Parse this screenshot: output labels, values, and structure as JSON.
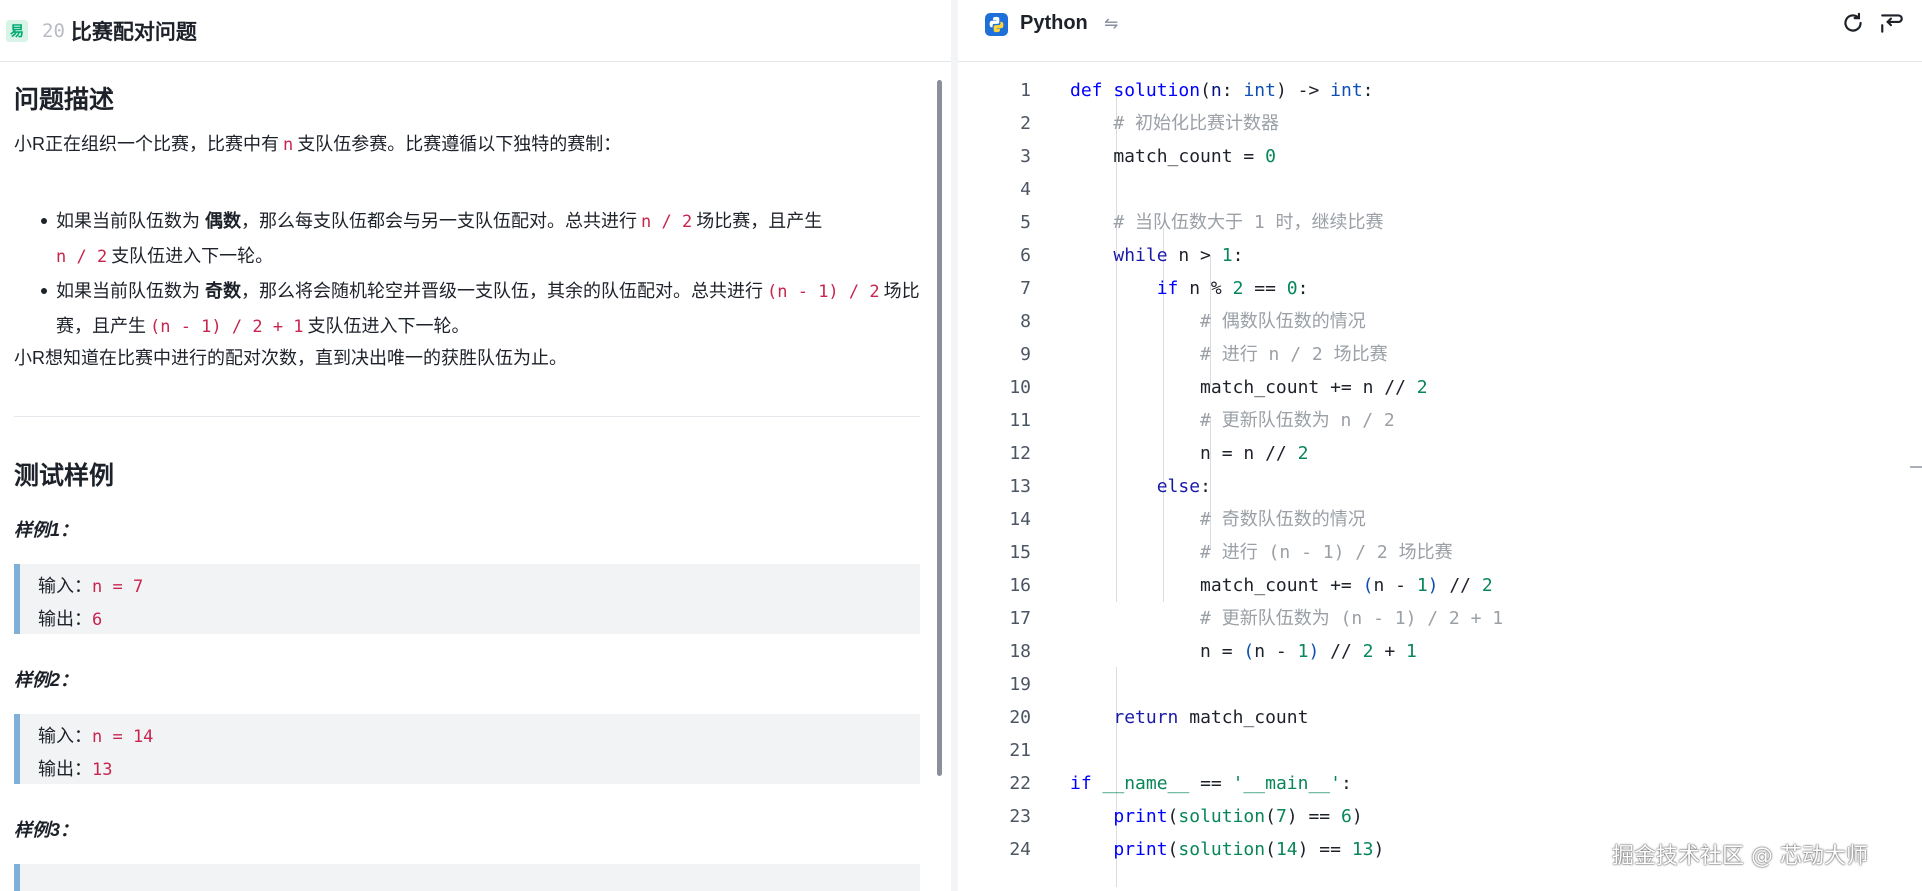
{
  "problem": {
    "difficulty": "易",
    "number": "20",
    "title": "比赛配对问题"
  },
  "description": {
    "heading": "问题描述",
    "intro_pre": "小R正在组织一个比赛，比赛中有",
    "intro_code": "n",
    "intro_post": "支队伍参赛。比赛遵循以下独特的赛制：",
    "bullet1": {
      "pre": "如果当前队伍数为",
      "bold": "偶数",
      "mid": "，那么每支队伍都会与另一支队伍配对。总共进行",
      "code1": "n / 2",
      "mid2": "场比赛，且产生",
      "code2": "n / 2",
      "post": "支队伍进入下一轮。"
    },
    "bullet2": {
      "pre": "如果当前队伍数为",
      "bold": "奇数",
      "mid": "，那么将会随机轮空并晋级一支队伍，其余的队伍配对。总共进行",
      "code1": "(n - 1) / 2",
      "mid2": "场比赛，且产生",
      "code2": "(n - 1) / 2 + 1",
      "post": "支队伍进入下一轮。"
    },
    "outro": "小R想知道在比赛中进行的配对次数，直到决出唯一的获胜队伍为止。"
  },
  "samples": {
    "heading": "测试样例",
    "input_label": "输入：",
    "output_label": "输出：",
    "items": [
      {
        "label": "样例1：",
        "input": "n = 7",
        "output": "6"
      },
      {
        "label": "样例2：",
        "input": "n = 14",
        "output": "13"
      },
      {
        "label": "样例3："
      }
    ]
  },
  "editor": {
    "language": "Python",
    "lines": [
      "1",
      "2",
      "3",
      "4",
      "5",
      "6",
      "7",
      "8",
      "9",
      "10",
      "11",
      "12",
      "13",
      "14",
      "15",
      "16",
      "17",
      "18",
      "19",
      "20",
      "21",
      "22",
      "23",
      "24"
    ],
    "comments": {
      "c2": "# 初始化比赛计数器",
      "c5": "# 当队伍数大于 1 时，继续比赛",
      "c8": "# 偶数队伍数的情况",
      "c9": "# 进行 n / 2 场比赛",
      "c11": "# 更新队伍数为 n / 2",
      "c14": "# 奇数队伍数的情况",
      "c15": "# 进行 (n - 1) / 2 场比赛",
      "c17": "# 更新队伍数为 (n - 1) / 2 + 1"
    }
  },
  "watermark": "掘金技术社区 @ 芯动大师",
  "icons": {
    "lang": "python-icon",
    "swap": "swap-icon",
    "reset": "reset-icon",
    "format": "format-icon"
  },
  "colors": {
    "keyword": "#0000ff",
    "number": "#098658",
    "comment": "#9aa0a6",
    "inline_code": "#c7254e",
    "sample_border": "#7fb0d8"
  }
}
